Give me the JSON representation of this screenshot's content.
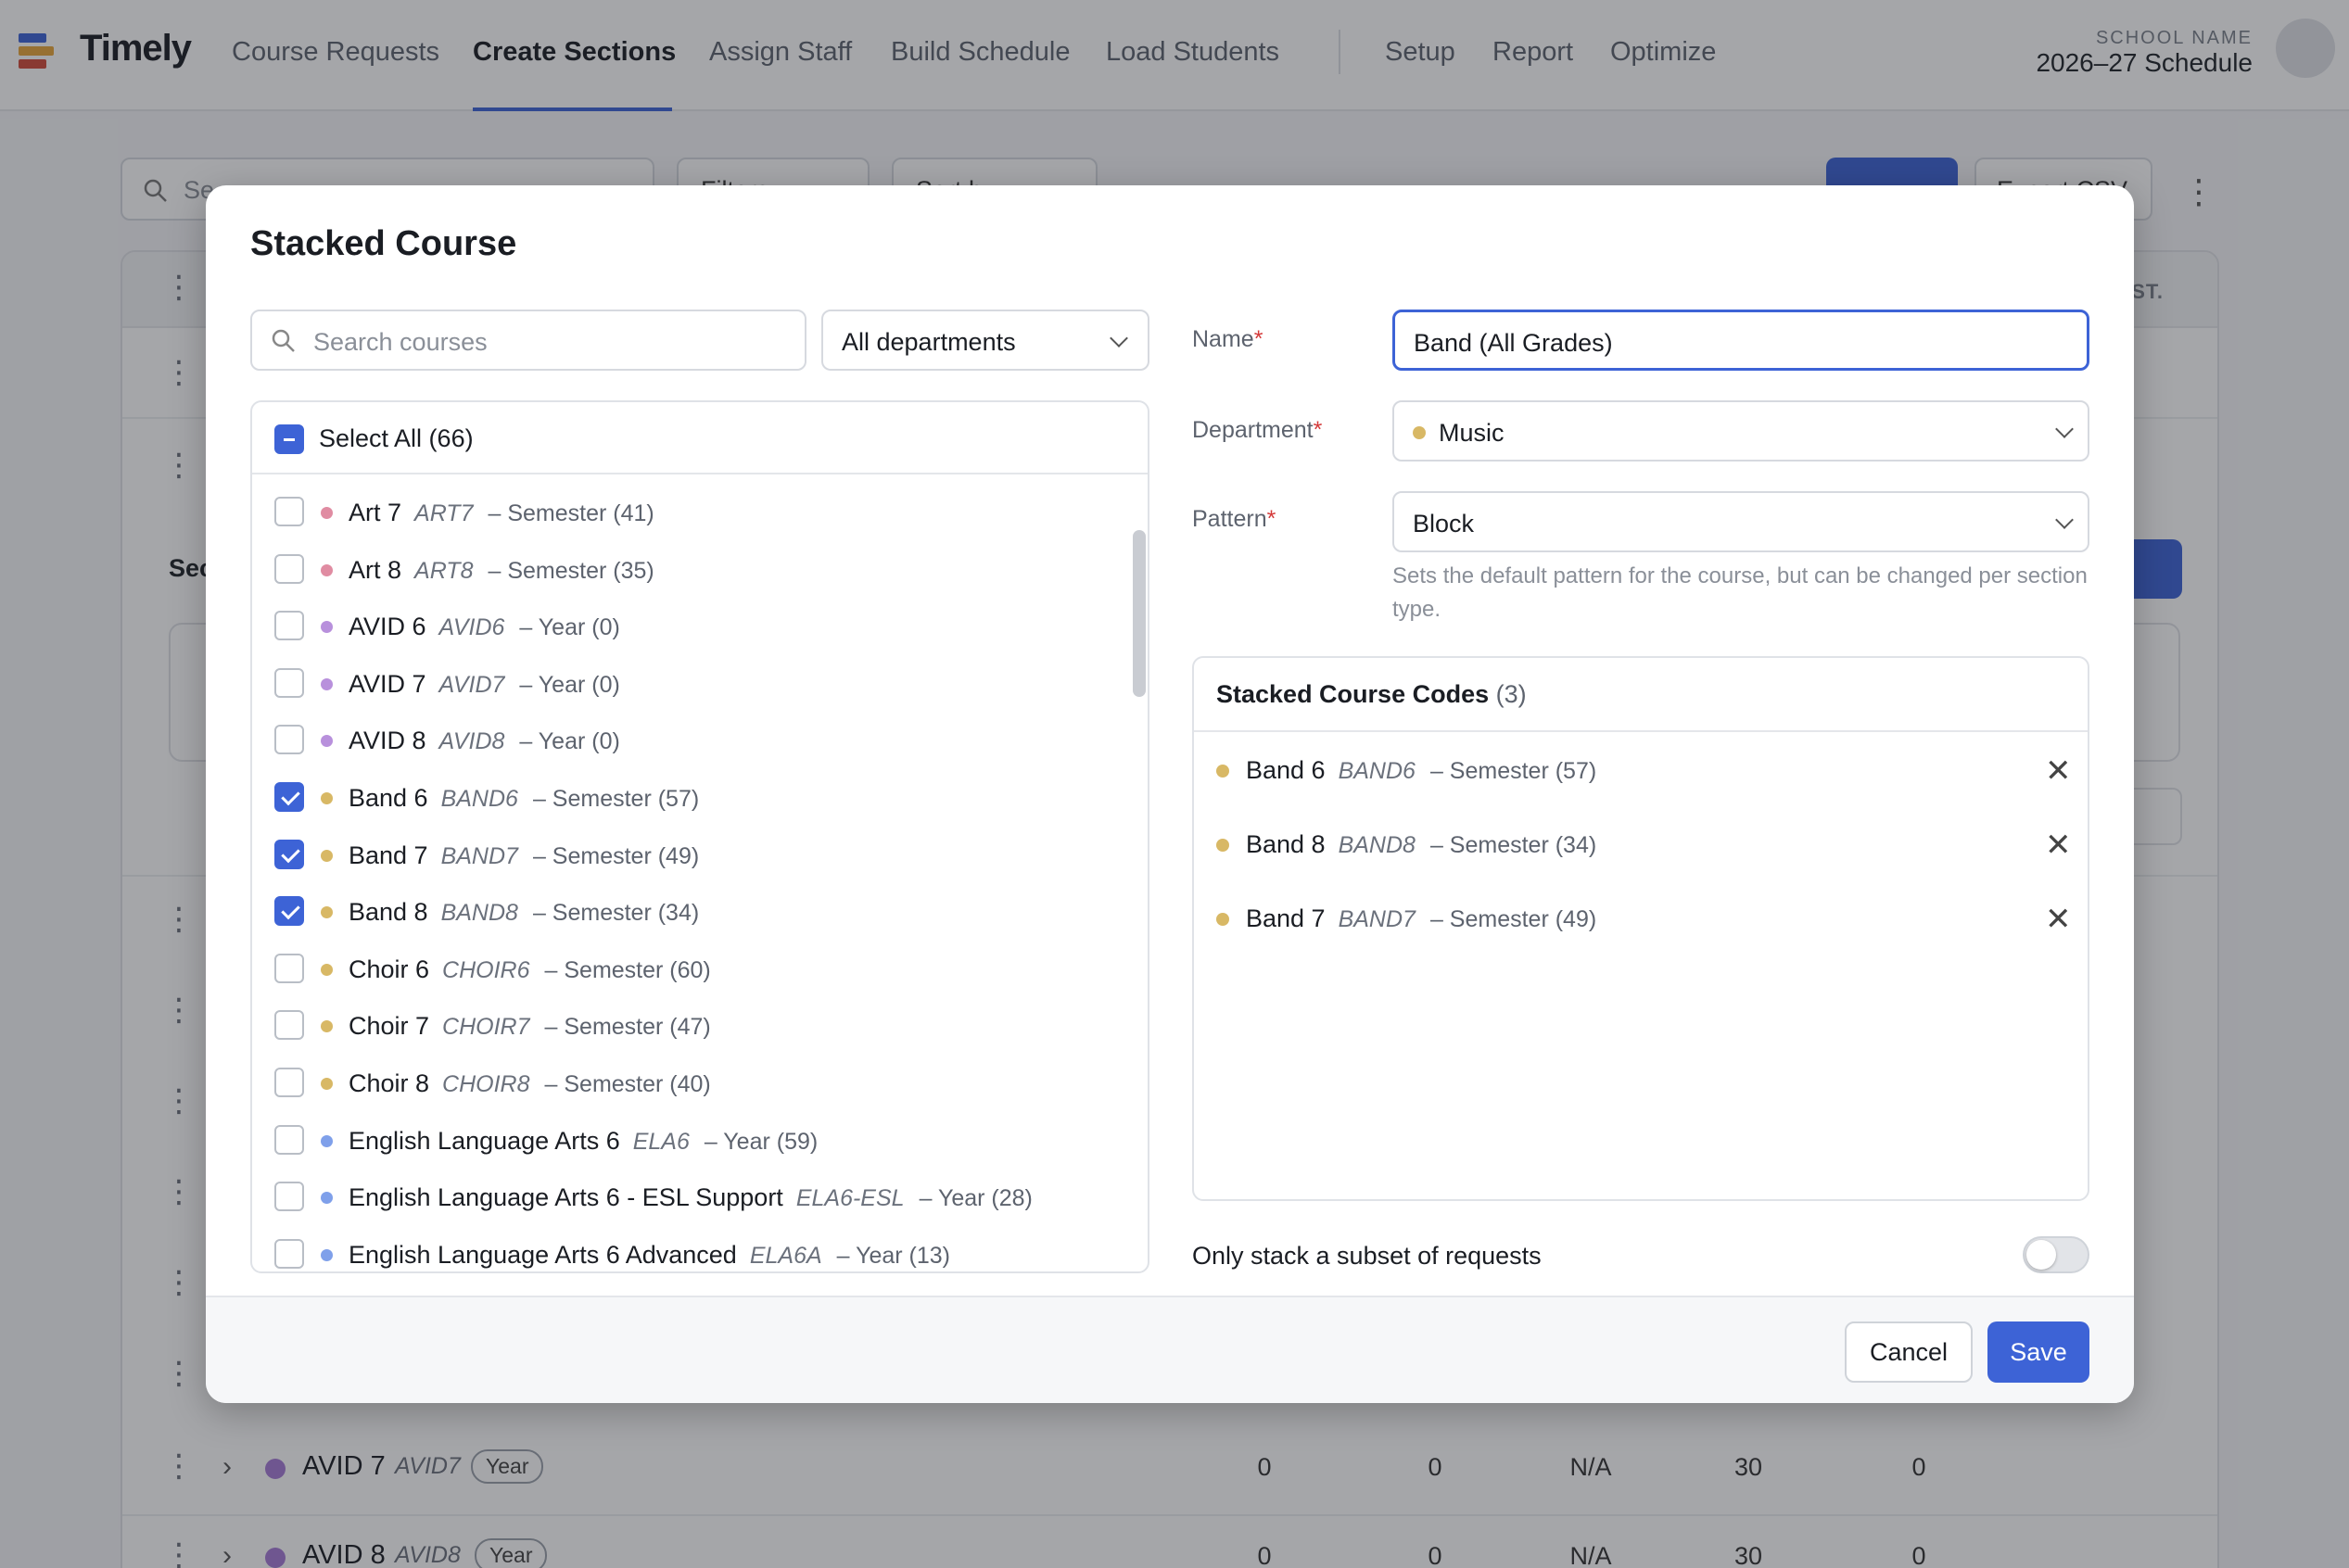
{
  "app": {
    "name": "Timely"
  },
  "nav": {
    "items": [
      {
        "label": "Course Requests"
      },
      {
        "label": "Create Sections"
      },
      {
        "label": "Assign Staff"
      },
      {
        "label": "Build Schedule"
      },
      {
        "label": "Load Students"
      },
      {
        "label": "Setup"
      },
      {
        "label": "Report"
      },
      {
        "label": "Optimize"
      }
    ],
    "active": "Create Sections"
  },
  "school": {
    "label": "SCHOOL NAME",
    "schedule": "2026–27 Schedule"
  },
  "background": {
    "search_text": "Se",
    "filters_label": "Filters",
    "sort_label": "Sort by",
    "export_label": "Export CSV",
    "column_est": "EST.",
    "sec_label": "Sec",
    "rows": [
      {
        "name": "AVID 7",
        "code": "AVID7",
        "tag": "Year",
        "values": [
          "0",
          "0",
          "N/A",
          "30",
          "0"
        ]
      },
      {
        "name": "AVID 8",
        "code": "AVID8",
        "tag": "Year",
        "values": [
          "0",
          "0",
          "N/A",
          "30",
          "0"
        ]
      }
    ]
  },
  "modal": {
    "title": "Stacked Course",
    "search_placeholder": "Search courses",
    "department_filter": "All departments",
    "select_all": "Select All (66)",
    "courses": [
      {
        "name": "Art 7",
        "code": "ART7",
        "term": "– Semester (41)",
        "color": "#e08ca2",
        "checked": false
      },
      {
        "name": "Art 8",
        "code": "ART8",
        "term": "– Semester (35)",
        "color": "#e08ca2",
        "checked": false
      },
      {
        "name": "AVID 6",
        "code": "AVID6",
        "term": "– Year (0)",
        "color": "#b890dc",
        "checked": false
      },
      {
        "name": "AVID 7",
        "code": "AVID7",
        "term": "– Year (0)",
        "color": "#b890dc",
        "checked": false
      },
      {
        "name": "AVID 8",
        "code": "AVID8",
        "term": "– Year (0)",
        "color": "#b890dc",
        "checked": false
      },
      {
        "name": "Band 6",
        "code": "BAND6",
        "term": "– Semester (57)",
        "color": "#d8b865",
        "checked": true
      },
      {
        "name": "Band 7",
        "code": "BAND7",
        "term": "– Semester (49)",
        "color": "#d8b865",
        "checked": true
      },
      {
        "name": "Band 8",
        "code": "BAND8",
        "term": "– Semester (34)",
        "color": "#d8b865",
        "checked": true
      },
      {
        "name": "Choir 6",
        "code": "CHOIR6",
        "term": "– Semester (60)",
        "color": "#d8b865",
        "checked": false
      },
      {
        "name": "Choir 7",
        "code": "CHOIR7",
        "term": "– Semester (47)",
        "color": "#d8b865",
        "checked": false
      },
      {
        "name": "Choir 8",
        "code": "CHOIR8",
        "term": "– Semester (40)",
        "color": "#d8b865",
        "checked": false
      },
      {
        "name": "English Language Arts 6",
        "code": "ELA6",
        "term": "– Year (59)",
        "color": "#7fa0ea",
        "checked": false
      },
      {
        "name": "English Language Arts 6 - ESL Support",
        "code": "ELA6-ESL",
        "term": "– Year (28)",
        "color": "#7fa0ea",
        "checked": false
      },
      {
        "name": "English Language Arts 6 Advanced",
        "code": "ELA6A",
        "term": "– Year (13)",
        "color": "#7fa0ea",
        "checked": false
      }
    ],
    "form": {
      "name_label": "Name",
      "name_value": "Band (All Grades)",
      "department_label": "Department",
      "department_value": "Music",
      "department_color": "#d8b865",
      "pattern_label": "Pattern",
      "pattern_value": "Block",
      "pattern_help": "Sets the default pattern for the course, but can be changed per section type.",
      "required_mark": "*"
    },
    "stacked": {
      "title": "Stacked Course Codes",
      "count": "(3)",
      "items": [
        {
          "name": "Band 6",
          "code": "BAND6",
          "term": "– Semester (57)"
        },
        {
          "name": "Band 8",
          "code": "BAND8",
          "term": "– Semester (34)"
        },
        {
          "name": "Band 7",
          "code": "BAND7",
          "term": "– Semester (49)"
        }
      ]
    },
    "subset_label": "Only stack a subset of requests",
    "subset_enabled": false,
    "cancel_label": "Cancel",
    "save_label": "Save"
  },
  "colors": {
    "accent": "#3d63d6",
    "music": "#d8b865",
    "art": "#e08ca2",
    "avid": "#b890dc",
    "ela": "#7fa0ea"
  }
}
